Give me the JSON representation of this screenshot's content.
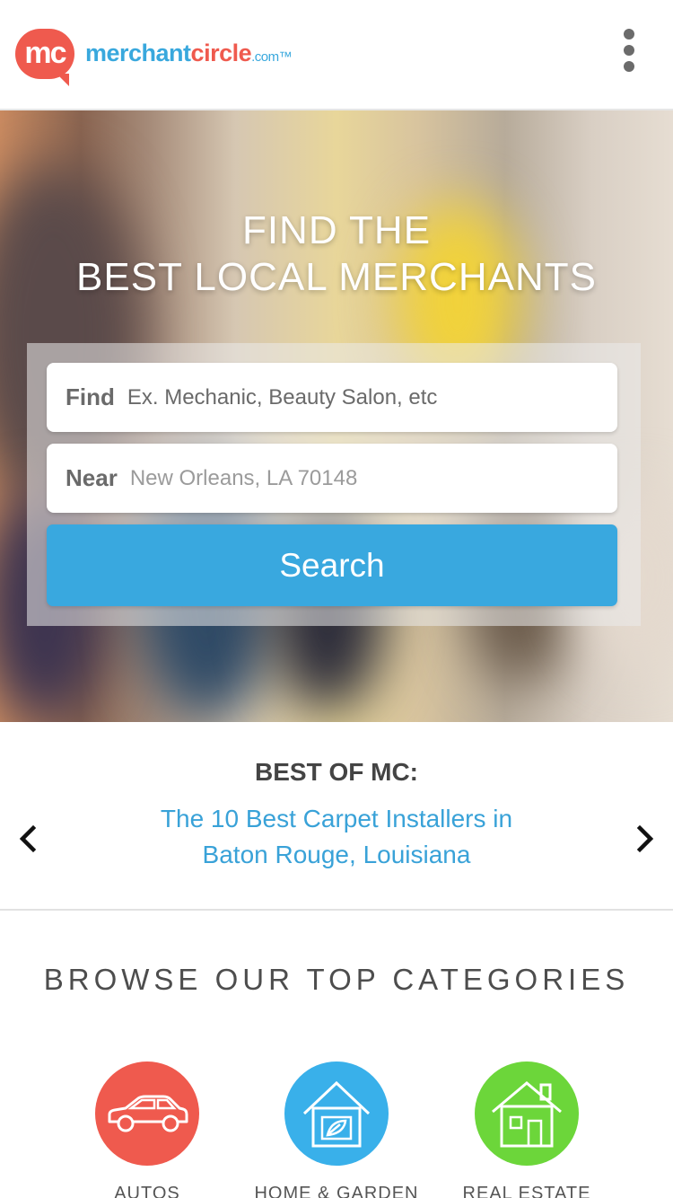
{
  "header": {
    "logo_mark": "mc",
    "logo_word_merchant": "merchant",
    "logo_word_circle": "circle",
    "logo_domain": ".com™"
  },
  "hero": {
    "title_line1": "FIND THE",
    "title_line2": "BEST LOCAL MERCHANTS",
    "find_label": "Find",
    "find_placeholder": "Ex. Mechanic, Beauty Salon, etc",
    "near_label": "Near",
    "near_placeholder": "New Orleans, LA 70148",
    "search_label": "Search"
  },
  "best_of": {
    "title": "BEST OF MC:",
    "link_text": "The 10 Best Carpet Installers in Baton Rouge, Louisiana"
  },
  "categories": {
    "title": "BROWSE OUR TOP CATEGORIES",
    "items": [
      {
        "label": "AUTOS",
        "color": "#ef5a4e",
        "icon": "car-icon"
      },
      {
        "label": "HOME & GARDEN",
        "color": "#39b0ea",
        "icon": "house-leaf-icon"
      },
      {
        "label": "REAL ESTATE",
        "color": "#6cd63a",
        "icon": "house-icon"
      }
    ]
  },
  "colors": {
    "brand_red": "#ef5a4e",
    "brand_blue": "#39a8dd",
    "search_button": "#39a8df"
  }
}
